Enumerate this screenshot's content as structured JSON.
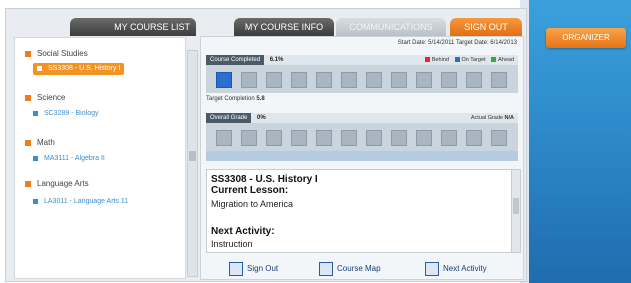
{
  "tabs": [
    {
      "label": "MY COURSE LIST"
    },
    {
      "label": "MY COURSE INFO"
    },
    {
      "label": "COMMUNICATIONS"
    },
    {
      "label": "SIGN OUT"
    }
  ],
  "organizer": {
    "label": "ORGANIZER"
  },
  "sidebar": {
    "groups": [
      {
        "subject": "Social Studies",
        "courses": [
          {
            "label": "SS3308 - U.S. History I",
            "active": true
          }
        ]
      },
      {
        "subject": "Science",
        "courses": [
          {
            "label": "SC3289 - Biology",
            "active": false
          }
        ]
      },
      {
        "subject": "Math",
        "courses": [
          {
            "label": "MA3111 - Algebra II",
            "active": false
          }
        ]
      },
      {
        "subject": "Language Arts",
        "courses": [
          {
            "label": "LA3011 - Language Arts 11",
            "active": false
          }
        ]
      }
    ]
  },
  "dates": {
    "text": "Start Date: 5/14/2011 Target Date: 6/14/2013"
  },
  "progress": {
    "label": "Course Completed",
    "percent": "6.1%",
    "legend": [
      {
        "label": "Behind",
        "color": "#d9302c"
      },
      {
        "label": "On Target",
        "color": "#2c6fd0"
      },
      {
        "label": "Ahead",
        "color": "#3aa83a"
      }
    ],
    "target_completion_label": "Target Completion",
    "target_completion_value": "5.8",
    "filled_cells": 1,
    "total_cells": 12
  },
  "grade": {
    "label": "Overall Grade",
    "percent": "0%",
    "actual_grade_label": "Actual Grade",
    "actual_grade_value": "N/A",
    "total_cells": 12
  },
  "detail": {
    "course_title": "SS3308 - U.S. History I",
    "current_lesson_label": "Current Lesson:",
    "current_lesson": "Migration to America",
    "next_activity_label": "Next Activity:",
    "next_activity": "Instruction"
  },
  "actions": [
    {
      "label": "Sign Out"
    },
    {
      "label": "Course Map"
    },
    {
      "label": "Next Activity"
    }
  ]
}
